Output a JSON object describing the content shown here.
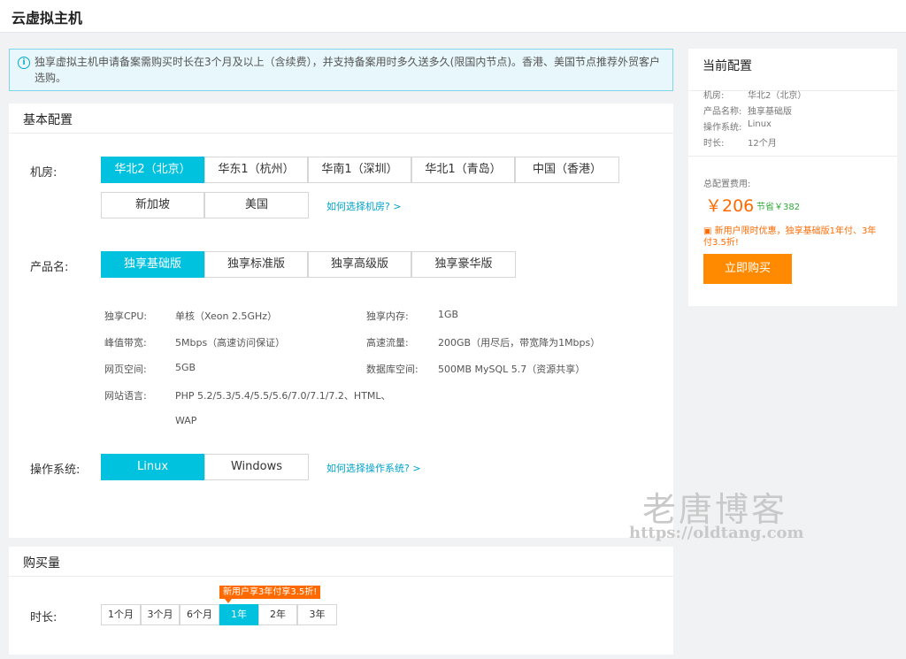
{
  "page": {
    "title": "云虚拟主机"
  },
  "notice": {
    "text": "独享虚拟主机申请备案需购买时长在3个月及以上（含续费），并支持备案用时多久送多久(限国内节点)。香港、美国节点推荐外贸客户选购。"
  },
  "basic": {
    "heading": "基本配置",
    "room": {
      "label": "机房:",
      "options": [
        "华北2（北京）",
        "华东1（杭州）",
        "华南1（深圳）",
        "华北1（青岛）",
        "中国（香港）",
        "新加坡",
        "美国"
      ],
      "selected": "华北2（北京）",
      "help": "如何选择机房? >"
    },
    "product": {
      "label": "产品名:",
      "options": [
        "独享基础版",
        "独享标准版",
        "独享高级版",
        "独享豪华版"
      ],
      "selected": "独享基础版"
    },
    "specs": {
      "cpu_k": "独享CPU:",
      "cpu_v": "单核（Xeon 2.5GHz）",
      "mem_k": "独享内存:",
      "mem_v": "1GB",
      "bw_k": "峰值带宽:",
      "bw_v": "5Mbps（高速访问保证）",
      "traffic_k": "高速流量:",
      "traffic_v": "200GB（用尽后，带宽降为1Mbps）",
      "web_k": "网页空间:",
      "web_v": "5GB",
      "db_k": "数据库空间:",
      "db_v": "500MB MySQL 5.7（资源共享）",
      "lang_k": "网站语言:",
      "lang_v1": "PHP 5.2/5.3/5.4/5.5/5.6/7.0/7.1/7.2、HTML、",
      "lang_v2": "WAP"
    },
    "os": {
      "label": "操作系统:",
      "options": [
        "Linux",
        "Windows"
      ],
      "selected": "Linux",
      "help": "如何选择操作系统? >"
    }
  },
  "purchase": {
    "heading": "购买量",
    "duration_label": "时长:",
    "promo": "新用户享3年付享3.5折!",
    "durations": [
      "1个月",
      "3个月",
      "6个月",
      "1年",
      "2年",
      "3年"
    ],
    "selected": "1年"
  },
  "summary": {
    "heading": "当前配置",
    "room_k": "机房:",
    "room_v": "华北2（北京）",
    "product_k": "产品名称:",
    "product_v": "独享基础版",
    "os_k": "操作系统:",
    "os_v": "Linux",
    "dur_k": "时长:",
    "dur_v": "12个月",
    "total_label": "总配置费用:",
    "price": "￥206",
    "save": "节省￥382",
    "promo_note": "新用户限时优惠，独享基础版1年付、3年付3.5折!",
    "buy": "立即购买"
  },
  "watermark": {
    "cn": "老唐博客",
    "url": "https://oldtang.com"
  },
  "colors": {
    "accent": "#00c1de",
    "orange": "#ff6a00",
    "buy": "#ff8a00",
    "save_green": "#2eaa3a"
  }
}
